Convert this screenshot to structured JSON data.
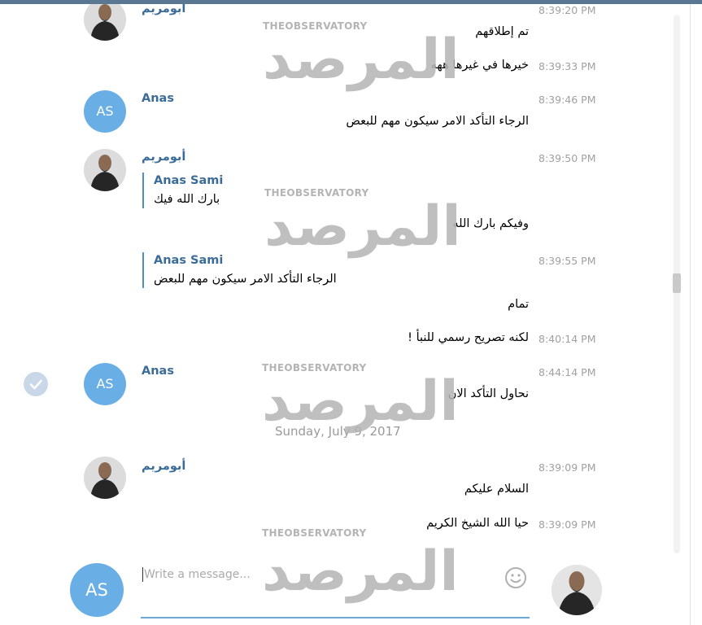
{
  "messages": [
    {
      "sender": "أبومريم",
      "time": "8:39:20 PM",
      "text": "تم إطلاقهم"
    },
    {
      "time": "8:39:33 PM",
      "text": "خيرها في غيرها ههه"
    },
    {
      "sender": "Anas",
      "avatar_initials": "AS",
      "time": "8:39:46 PM",
      "text": "الرجاء التأكد الامر سيكون مهم للبعض"
    },
    {
      "sender": "أبومريم",
      "time": "8:39:50 PM",
      "reply_name": "Anas Sami",
      "reply_text": "بارك الله فيك",
      "text": "وفيكم بارك الله"
    },
    {
      "time": "8:39:55 PM",
      "reply_name": "Anas Sami",
      "reply_text": "الرجاء التأكد الامر سيكون مهم للبعض",
      "text": "تمام"
    },
    {
      "time": "8:40:14 PM",
      "text": "لكنه تصريح رسمي للنبأ !"
    },
    {
      "sender": "Anas",
      "avatar_initials": "AS",
      "time": "8:44:14 PM",
      "text": "نحاول التأكد الان"
    },
    {
      "sender": "أبومريم",
      "time": "8:39:09 PM",
      "text": "السلام عليكم"
    },
    {
      "time": "8:39:09 PM",
      "text": "حيا الله الشيخ الكريم"
    }
  ],
  "date_separator": "Sunday, July 9, 2017",
  "composer": {
    "avatar_initials": "AS",
    "placeholder": "Write a message..."
  },
  "watermark": {
    "label": "THEOBSERVATORY",
    "arabic": "المرصد"
  },
  "colors": {
    "accent": "#6aaee6",
    "sender_name": "#3b6c99",
    "topbar": "#5a7791"
  }
}
